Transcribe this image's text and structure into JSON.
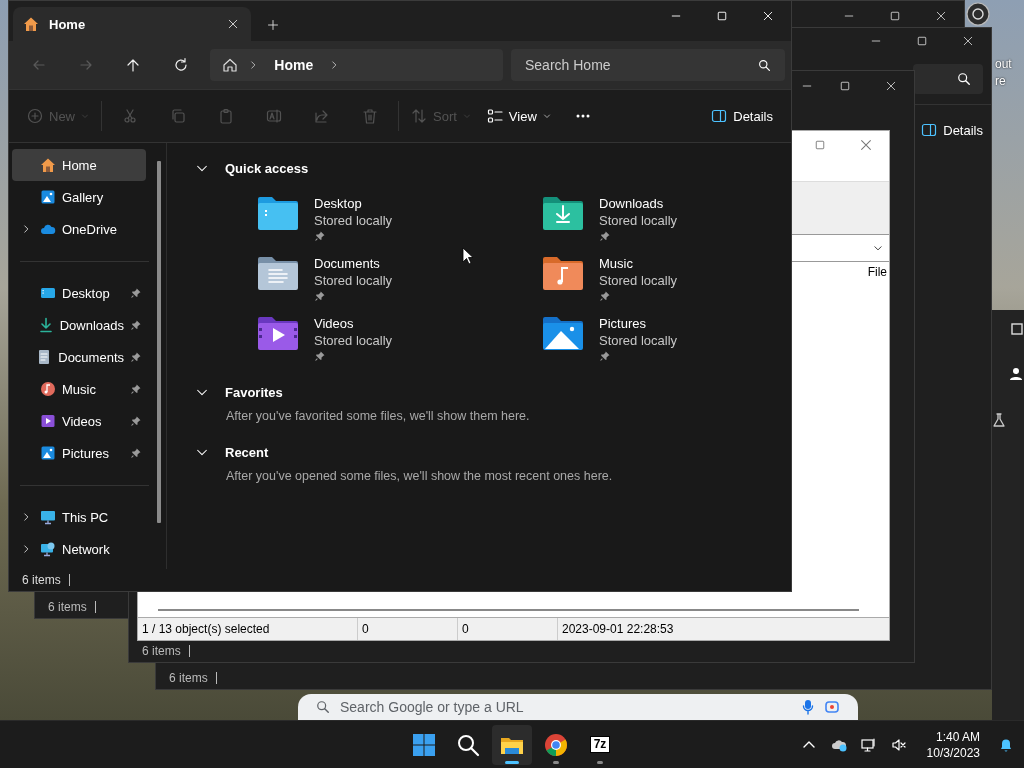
{
  "background_windows": [
    {
      "kind": "archiver",
      "column": "File",
      "status_cells": [
        "1 / 13 object(s) selected",
        "0",
        "0",
        "2023-09-01 22:28:53"
      ]
    },
    {
      "kind": "explorer",
      "status": "6 items"
    },
    {
      "kind": "explorer",
      "status": "6 items",
      "details": "Details"
    },
    {
      "kind": "explorer",
      "status": "6 items"
    }
  ],
  "desktop": {
    "texts": [
      "out",
      "re"
    ]
  },
  "browser": {
    "placeholder": "Search Google or type a URL"
  },
  "explorer": {
    "tabs": [
      {
        "label": "Home",
        "selected": true
      }
    ],
    "nav_buttons": [
      {
        "kind": "back",
        "disabled": true
      },
      {
        "kind": "forward",
        "disabled": true
      },
      {
        "kind": "up",
        "disabled": false
      },
      {
        "kind": "refresh",
        "disabled": false
      }
    ],
    "breadcrumb": [
      "Home"
    ],
    "search": {
      "placeholder": "Search Home"
    },
    "toolbar": [
      {
        "kind": "new",
        "label": "New",
        "disabled": true
      },
      {
        "kind": "cut",
        "disabled": true
      },
      {
        "kind": "copy",
        "disabled": true
      },
      {
        "kind": "paste",
        "disabled": true
      },
      {
        "kind": "rename",
        "disabled": true
      },
      {
        "kind": "share",
        "disabled": true
      },
      {
        "kind": "delete",
        "disabled": true
      },
      {
        "kind": "sort",
        "label": "Sort",
        "disabled": true
      },
      {
        "kind": "view",
        "label": "View",
        "disabled": false
      },
      {
        "kind": "more",
        "disabled": false
      }
    ],
    "details_button": "Details",
    "sidebar": [
      [
        {
          "label": "Home",
          "kind": "home",
          "selected": true
        },
        {
          "label": "Gallery",
          "kind": "gallery",
          "selected": false
        },
        {
          "label": "OneDrive",
          "kind": "cloud",
          "selected": false,
          "expanded": false
        }
      ],
      [
        {
          "label": "Desktop",
          "kind": "desktop",
          "selected": false,
          "pinned": true
        },
        {
          "label": "Downloads",
          "kind": "downloads",
          "selected": false,
          "pinned": true
        },
        {
          "label": "Documents",
          "kind": "documents",
          "selected": false,
          "pinned": true
        },
        {
          "label": "Music",
          "kind": "music",
          "selected": false,
          "pinned": true
        },
        {
          "label": "Videos",
          "kind": "videos",
          "selected": false,
          "pinned": true
        },
        {
          "label": "Pictures",
          "kind": "pictures",
          "selected": false,
          "pinned": true
        }
      ],
      [
        {
          "label": "This PC",
          "kind": "pc",
          "selected": false,
          "expanded": false
        },
        {
          "label": "Network",
          "kind": "network",
          "selected": false,
          "expanded": false
        }
      ]
    ],
    "sections": [
      {
        "title": "Quick access",
        "expanded": true,
        "items": [
          {
            "name": "Desktop",
            "detail": "Stored locally",
            "pinned": true,
            "kind": "desktop"
          },
          {
            "name": "Downloads",
            "detail": "Stored locally",
            "pinned": true,
            "kind": "downloads"
          },
          {
            "name": "Documents",
            "detail": "Stored locally",
            "pinned": true,
            "kind": "documents"
          },
          {
            "name": "Music",
            "detail": "Stored locally",
            "pinned": true,
            "kind": "music"
          },
          {
            "name": "Videos",
            "detail": "Stored locally",
            "pinned": true,
            "kind": "videos"
          },
          {
            "name": "Pictures",
            "detail": "Stored locally",
            "pinned": true,
            "kind": "pictures"
          }
        ]
      },
      {
        "title": "Favorites",
        "expanded": true,
        "message": "After you've favorited some files, we'll show them here."
      },
      {
        "title": "Recent",
        "expanded": true,
        "message": "After you've opened some files, we'll show the most recent ones here."
      }
    ],
    "status": "6 items"
  },
  "taskbar": {
    "apps": [
      {
        "kind": "start",
        "running": false,
        "active": false
      },
      {
        "kind": "search",
        "running": false,
        "active": false
      },
      {
        "kind": "explorer",
        "running": true,
        "active": true
      },
      {
        "kind": "chrome",
        "running": true,
        "active": false
      },
      {
        "kind": "archiver",
        "label": "7z",
        "running": true,
        "active": false
      }
    ],
    "time": "1:40 AM",
    "date": "10/3/2023"
  }
}
